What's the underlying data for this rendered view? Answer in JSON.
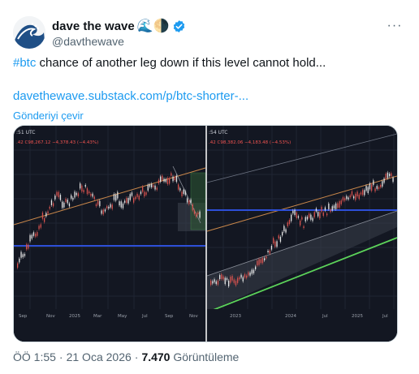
{
  "author": {
    "display_name": "dave the wave",
    "emoji": "🌊🌗",
    "handle": "@davthewave"
  },
  "tweet": {
    "hashtag": "#btc",
    "text": " chance of another leg down if this level cannot hold...",
    "link": "davethewave.substack.com/p/btc-shorter-...",
    "translate": "Gönderiyi çevir"
  },
  "charts": {
    "left": {
      "time_label": ":51 UTC",
      "ohlc": ".42  C98,267.12  −4,378.43 (−4.43%)",
      "x_labels": [
        "Sep",
        "Nov",
        "2025",
        "Mar",
        "May",
        "Jul",
        "Sep",
        "Nov"
      ]
    },
    "right": {
      "time_label": ":54 UTC",
      "ohlc": ".42  C98,382.06  −4,183.48 (−4.53%)",
      "x_labels": [
        "2023",
        "2024",
        "Jul",
        "2025",
        "Jul"
      ]
    }
  },
  "footer": {
    "time": "ÖÖ 1:55",
    "date": "21 Oca 2026",
    "views": "7.470",
    "views_label": "Görüntüleme"
  },
  "colors": {
    "accent": "#1d9bf0",
    "chart_bg": "#131722",
    "candle_up": "#e8e8e8",
    "candle_down": "#d9534f",
    "blue_line": "#2d4fd8",
    "green_line": "#5cd35a",
    "orange_line": "#c9874a"
  }
}
